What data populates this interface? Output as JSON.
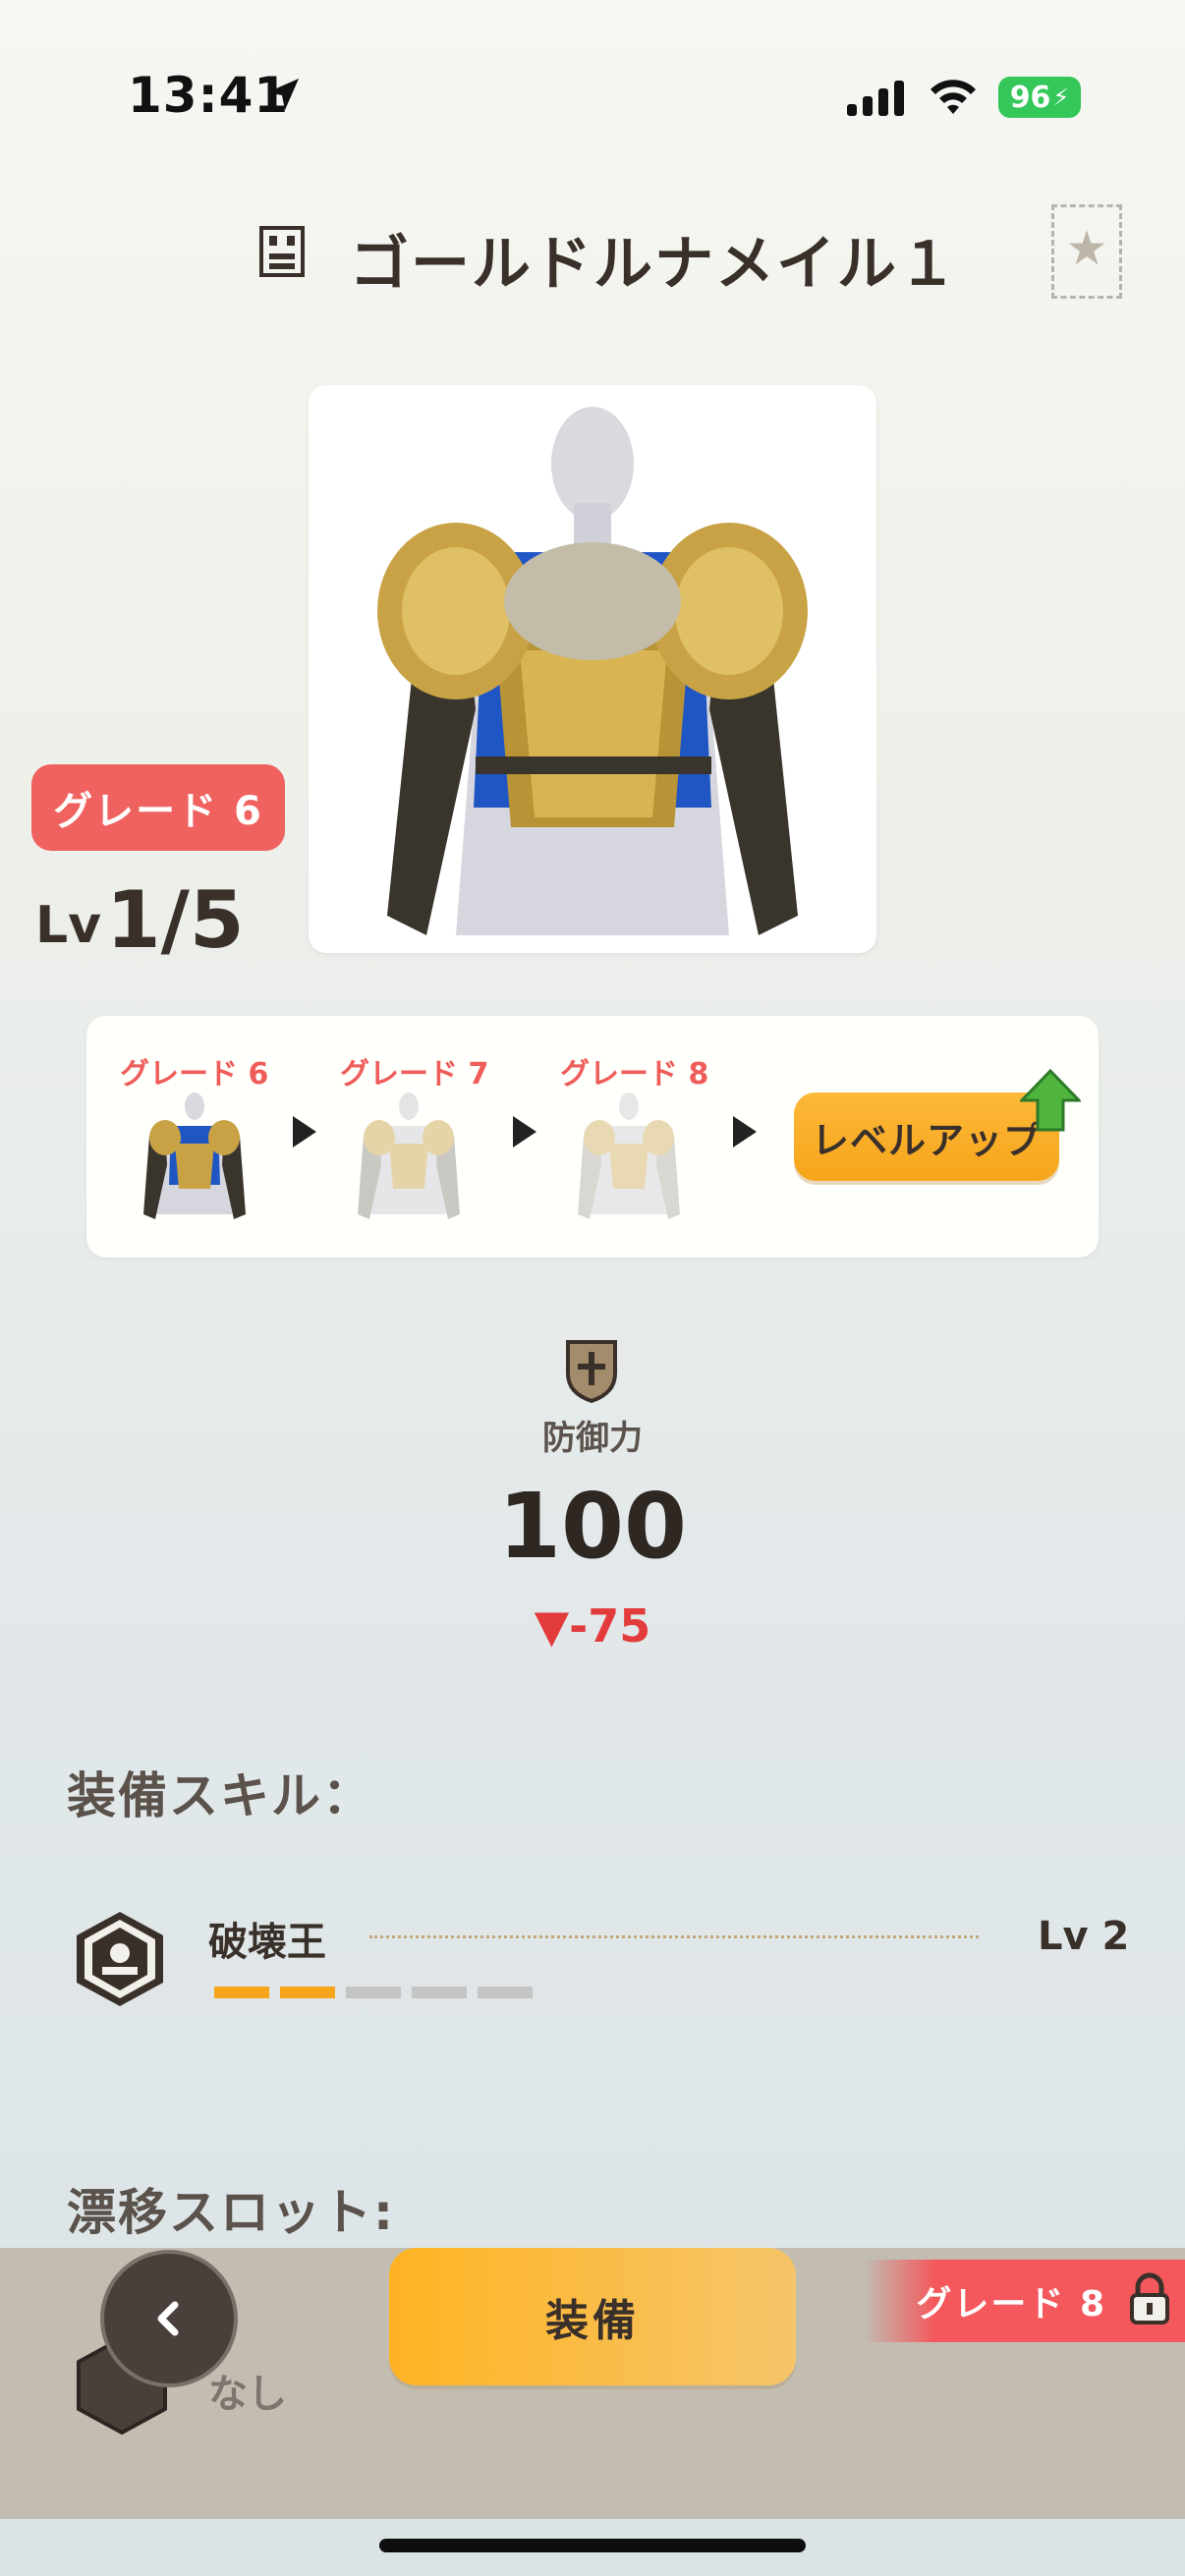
{
  "status": {
    "time": "13:41",
    "battery": "96"
  },
  "item": {
    "title": "ゴールドルナメイル１",
    "grade": "グレード 6",
    "level_prefix": "Lv",
    "level": "1/5"
  },
  "progression": {
    "grades": [
      "グレード 6",
      "グレード 7",
      "グレード 8"
    ],
    "level_up_label": "レベルアップ"
  },
  "defense": {
    "label": "防御力",
    "value": "100",
    "diff": "▼-75"
  },
  "skills": {
    "section_title": "装備スキル：",
    "items": [
      {
        "name": "破壊王",
        "level": "Lv 2",
        "filled": 2,
        "total": 5
      }
    ]
  },
  "drift": {
    "section_title": "漂移スロット:",
    "none_label": "なし",
    "lock_label": "グレード 8"
  },
  "actions": {
    "equip_label": "装備"
  },
  "colors": {
    "accent_orange": "#f6a51a",
    "grade_red": "#f0625f",
    "diff_red": "#e33b3b"
  }
}
